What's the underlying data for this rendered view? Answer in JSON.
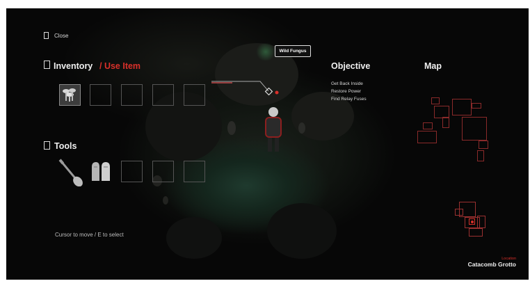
{
  "close": {
    "label": "Close"
  },
  "inventory": {
    "title": "Inventory",
    "action": "/ Use Item"
  },
  "tools": {
    "title": "Tools"
  },
  "hint": "Cursor to move / E to select",
  "tooltip": {
    "label": "Wild Fungus"
  },
  "objective": {
    "title": "Objective",
    "items": [
      "Get Back Inside",
      "Restore Power",
      "Find Relay Fuses"
    ]
  },
  "map": {
    "title": "Map"
  },
  "location": {
    "label": "Location",
    "name": "Catacomb Grotto"
  },
  "colors": {
    "accent": "#d9302a",
    "text": "#f0f0f0",
    "slot_border": "#555555",
    "map_room": "#8a2a2a"
  }
}
